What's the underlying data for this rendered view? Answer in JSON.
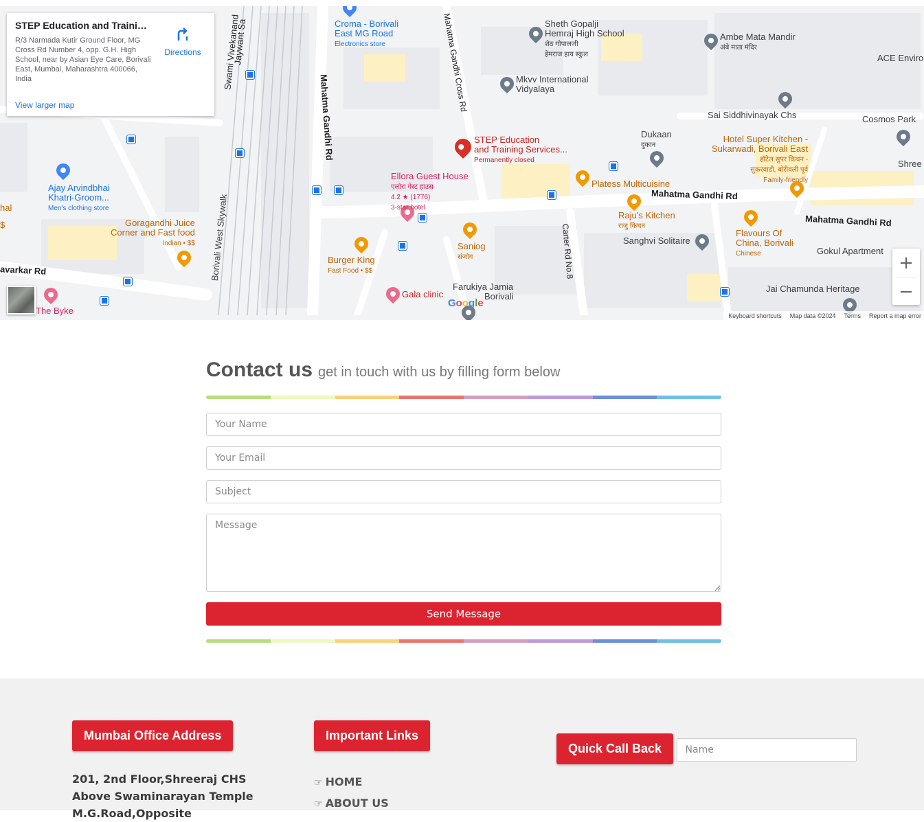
{
  "map": {
    "place_card": {
      "title": "STEP Education and Training ...",
      "address": "R/3 Narmada Kutir Ground Floor, MG Cross Rd Number 4, opp. G.H. High School, near by Asian Eye Care, Borivali East, Mumbai, Maharashtra 400066, India",
      "directions_label": "Directions",
      "view_larger": "View larger map"
    },
    "labels": {
      "croma": "Croma - Borivali",
      "croma2": "East MG Road",
      "croma_sub": "Electronics store",
      "sheth": "Sheth Gopalji",
      "sheth2": "Hemraj High School",
      "sheth_hi": "शेठ गोपालजी",
      "sheth_hi2": "हेमराज हाय स्कुल",
      "ambe": "Ambe Mata Mandir",
      "ambe_hi": "अंबे माता मंदिर",
      "ace": "ACE Enviro",
      "mkvv": "Mkvv International",
      "mkvv2": "Vidyalaya",
      "sai": "Sai Siddhivinayak Chs",
      "cosmos": "Cosmos Park",
      "step": "STEP Education",
      "step2": "and Training Services...",
      "step_status": "Permanently closed",
      "dukaan": "Dukaan",
      "dukaan_hi": "दुकान",
      "hotel": "Hotel Super Kitchen -",
      "hotel2": "Sukarwadi, Borivali East",
      "hotel_hi": "हॉटेल सुपर किचन -",
      "hotel_hi2": "सुकरवाडी, बोरीवली पूर्व",
      "hotel_sub": "Family-friendly",
      "shree": "Shree",
      "ellora": "Ellora Guest House",
      "ellora_hi": "एलोरा गेस्ट हाउस",
      "ellora_rating": "4.2 ★ (1776)",
      "ellora_sub": "3-star hotel",
      "platess": "Platess Multicuisine",
      "mg_road1": "Mahatma Gandhi Rd",
      "mg_road2": "Mahatma Gandhi Rd",
      "ajay": "Ajay Arvindbhai",
      "ajay2": "Khatri-Groom...",
      "ajay_sub": "Men's clothing store",
      "goragandhi": "Goragandhi Juice",
      "goragandhi2": "Corner and Fast food",
      "goragandhi_sub": "Indian • $$",
      "raju": "Raju's Kitchen",
      "raju_hi": "राजु किचन",
      "sanghvi": "Sanghvi Solitaire",
      "flavours": "Flavours Of",
      "flavours2": "China, Borivali",
      "flavours_sub": "Chinese",
      "gokul": "Gokul Apartment",
      "saniog": "Saniog",
      "saniog_hi": "संजोग",
      "burger": "Burger King",
      "burger_sub": "Fast Food • $$",
      "gala": "Gala clinic",
      "farukiya": "Farukiya Jamia",
      "borivali": "Borivali",
      "jai": "Jai Chamunda Heritage",
      "byke": "The Byke",
      "savarkar": "avarkar Rd",
      "hal": "hal",
      "dollar": "$",
      "skywalk": "Borivali West Skywalk",
      "swami": "Swami Vivekanand",
      "jaywant": "Jaywant Sa",
      "mg_vert": "Mahatma Gandhi Rd",
      "mg_cross": "Mahatma Gandhi Cross Rd",
      "carter": "Carter Rd No.8"
    },
    "zoom_in": "+",
    "zoom_out": "−",
    "google": [
      "G",
      "o",
      "o",
      "g",
      "l",
      "e"
    ],
    "attribution": {
      "shortcuts": "Keyboard shortcuts",
      "data": "Map data ©2024",
      "terms": "Terms",
      "report": "Report a map error"
    }
  },
  "contact": {
    "title": "Contact us",
    "subtitle": "get in touch with us by filling form below",
    "name_placeholder": "Your Name",
    "email_placeholder": "Your Email",
    "subject_placeholder": "Subject",
    "message_placeholder": "Message",
    "send_label": "Send Message",
    "rainbow_colors": [
      "#b9dc7e",
      "#eef7c2",
      "#fbd27a",
      "#e8766f",
      "#d39fc0",
      "#bf99d8",
      "#6b8fd8",
      "#6fc0e0"
    ]
  },
  "footer": {
    "address_heading": "Mumbai Office Address",
    "address_line1": "201, 2nd Floor,Shreeraj CHS",
    "address_line2": "Above Swaminarayan Temple",
    "address_line3": "M.G.Road,Opposite",
    "links_heading": "Important Links",
    "links": [
      "HOME",
      "ABOUT US"
    ],
    "callback_heading": "Quick Call Back",
    "name_placeholder": "Name"
  },
  "colors": {
    "accent_red": "#dc2430",
    "footer_bg": "#f1f1f1"
  }
}
